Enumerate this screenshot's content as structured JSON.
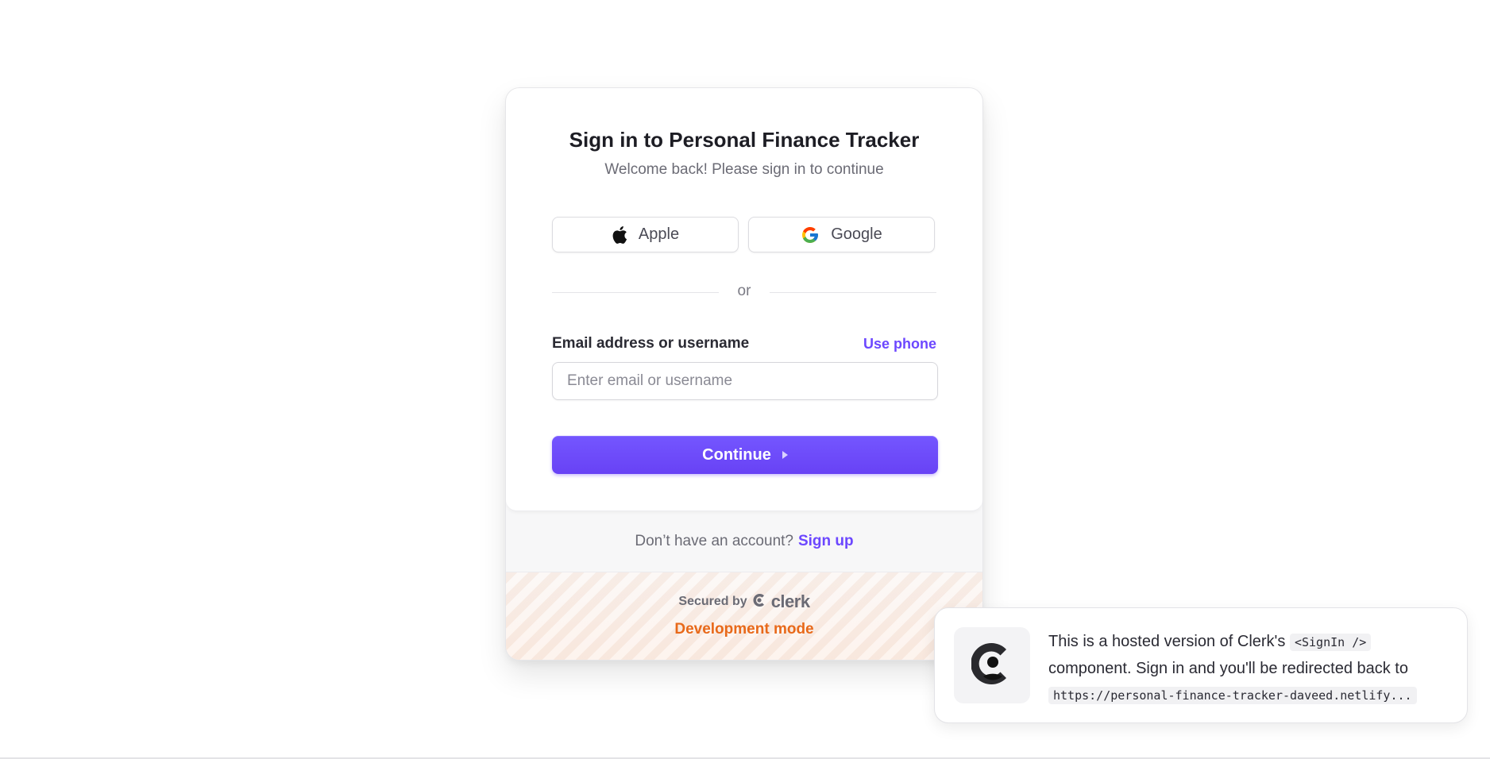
{
  "signin": {
    "title": "Sign in to Personal Finance Tracker",
    "subtitle": "Welcome back! Please sign in to continue",
    "social": {
      "apple_label": "Apple",
      "google_label": "Google"
    },
    "divider_text": "or",
    "field_label": "Email address or username",
    "use_phone_label": "Use phone",
    "email_placeholder": "Enter email or username",
    "email_value": "",
    "continue_label": "Continue"
  },
  "footer": {
    "no_account_text": "Don’t have an account?",
    "signup_label": "Sign up",
    "secured_by": "Secured by",
    "clerk_brand": "clerk",
    "dev_mode": "Development mode"
  },
  "toast": {
    "text_before": "This is a hosted version of Clerk's",
    "code_component": "<SignIn />",
    "text_after": "component. Sign in and you'll be redirected back to",
    "code_url": "https://personal-finance-tracker-daveed.netlify..."
  },
  "colors": {
    "accent": "#6c47ff",
    "dev_mode": "#e8691a",
    "title": "#1d1d24",
    "muted": "#6b6b75"
  },
  "icons": [
    "apple-icon",
    "google-icon",
    "continue-caret-icon",
    "clerk-logo-icon",
    "clerk-toast-logo-icon"
  ]
}
